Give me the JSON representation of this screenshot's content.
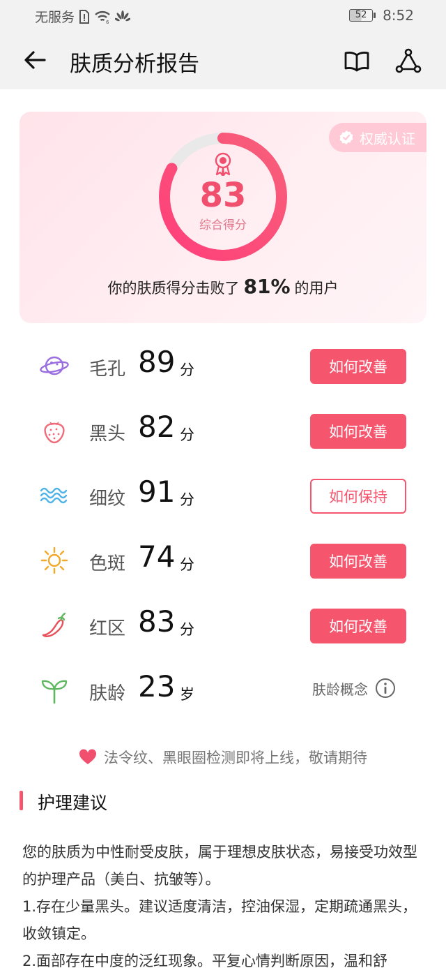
{
  "status_bar": {
    "carrier": "无服务",
    "time": "8:52",
    "battery": "52"
  },
  "header": {
    "title": "肤质分析报告"
  },
  "score_card": {
    "badge": "权威认证",
    "score": "83",
    "score_label": "综合得分",
    "score_fraction": 0.83,
    "beat_prefix": "你的肤质得分击败了",
    "beat_percent": "81%",
    "beat_suffix": "的用户"
  },
  "metrics": [
    {
      "name": "毛孔",
      "value": "89",
      "unit": "分",
      "action": "如何改善",
      "icon": "planet-icon"
    },
    {
      "name": "黑头",
      "value": "82",
      "unit": "分",
      "action": "如何改善",
      "icon": "strawberry-icon"
    },
    {
      "name": "细纹",
      "value": "91",
      "unit": "分",
      "action": "如何保持",
      "icon": "wave-icon"
    },
    {
      "name": "色斑",
      "value": "74",
      "unit": "分",
      "action": "如何改善",
      "icon": "sun-icon"
    },
    {
      "name": "红区",
      "value": "83",
      "unit": "分",
      "action": "如何改善",
      "icon": "chili-icon"
    },
    {
      "name": "肤龄",
      "value": "23",
      "unit": "岁",
      "action": "肤龄概念",
      "icon": "sprout-icon"
    }
  ],
  "notice": "法令纹、黑眼圈检测即将上线，敬请期待",
  "section_title": "护理建议",
  "advice": [
    "您的肤质为中性耐受皮肤，属于理想皮肤状态，易接受功效型的护理产品（美白、抗皱等）。",
    "1.存在少量黑头。建议适度清洁，控油保湿，定期疏通黑头，收敛镇定。",
    "2.面部存在中度的泛红现象。平复心情判断原因，温和舒"
  ],
  "colors": {
    "accent": "#f5566e",
    "ring_start": "#ff3f7a",
    "ring_end": "#f7607a",
    "track": "#e9e9e9"
  }
}
